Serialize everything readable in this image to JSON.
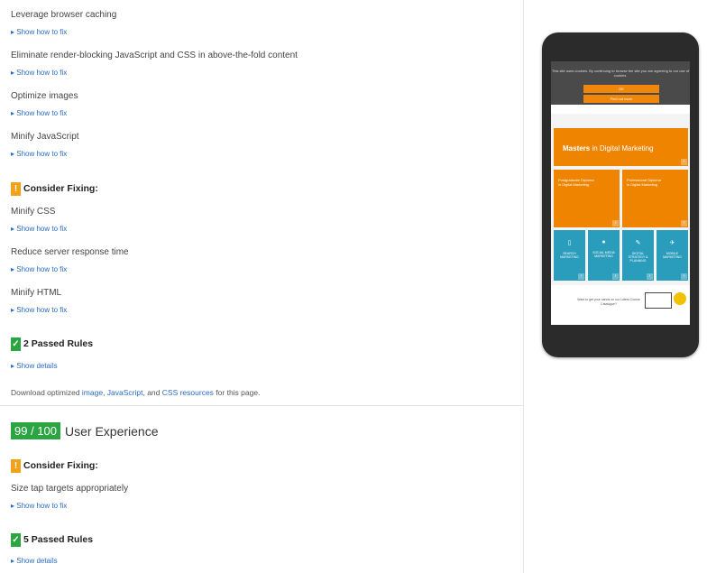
{
  "speed_rules": [
    {
      "title": "Leverage browser caching",
      "link": "▸ Show how to fix"
    },
    {
      "title": "Eliminate render-blocking JavaScript and CSS in above-the-fold content",
      "link": "▸ Show how to fix"
    },
    {
      "title": "Optimize images",
      "link": "▸ Show how to fix"
    },
    {
      "title": "Minify JavaScript",
      "link": "▸ Show how to fix"
    }
  ],
  "consider_fixing": {
    "label": "Consider Fixing:",
    "items": [
      {
        "title": "Minify CSS",
        "link": "▸ Show how to fix"
      },
      {
        "title": "Reduce server response time",
        "link": "▸ Show how to fix"
      },
      {
        "title": "Minify HTML",
        "link": "▸ Show how to fix"
      }
    ]
  },
  "passed_1": {
    "label": "2 Passed Rules",
    "link": "▸ Show details"
  },
  "download": {
    "prefix": "Download optimized ",
    "link_image": "image",
    "sep1": ", ",
    "link_js": "JavaScript",
    "sep2": ", and ",
    "link_css": "CSS resources",
    "suffix": " for this page."
  },
  "ux": {
    "score": "99 / 100",
    "title": "User Experience",
    "consider_label": "Consider Fixing:",
    "item_title": "Size tap targets appropriately",
    "item_link": "▸ Show how to fix",
    "passed_label": "5 Passed Rules",
    "passed_link": "▸ Show details"
  },
  "badges": {
    "warn": "!",
    "pass": "✓"
  },
  "phone": {
    "cookie_text": "This site uses cookies. By continuing to browse the site you are agreeing to our use of cookies.",
    "cookie_ok": "OK",
    "cookie_more": "Find out more",
    "masters_bold": "Masters",
    "masters_rest": " in Digital Marketing",
    "tile_left": "Postgraduate Diploma in Digital Marketing",
    "tile_right": "Professional Diploma in Digital Marketing",
    "tiles_blue": [
      "SEARCH MARKETING",
      "SOCIAL MEDIA MARKETING",
      "DIGITAL STRATEGY & PLANNING",
      "MOBILE MARKETING"
    ],
    "bottom_text": "Want to get your hands on our Latest Course Catalogue?",
    "arrow": "›"
  },
  "colors": {
    "warn": "#f0a21b",
    "pass": "#2aa541",
    "link": "#2a6cc1",
    "orange": "#ee8400",
    "teal": "#2a9cbc"
  }
}
